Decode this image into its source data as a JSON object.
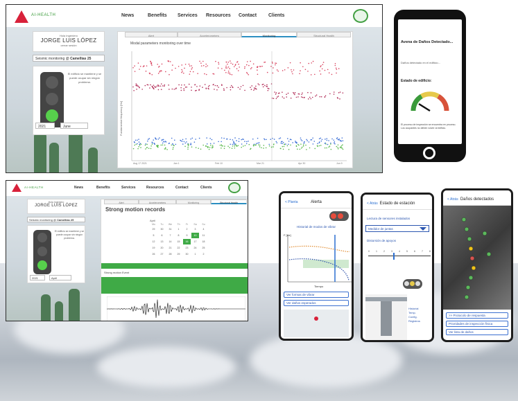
{
  "site": {
    "brand": "AI-HEALTH",
    "nav": [
      "News",
      "Benefits",
      "Services",
      "Resources",
      "Contact",
      "Clients"
    ]
  },
  "dashboard_top": {
    "welcome": "Hola Ingeniero",
    "user_name": "JORGE LUIS LÓPEZ",
    "logout": "cerrar sesión",
    "monitoring_label": "Seismic monitoring @",
    "site_name": "Camellias 25",
    "status_text": "El edificio se mantiene y se puede ocupar sin ningún problema.",
    "years": [
      "2021",
      "June"
    ],
    "tabs": [
      "Alert",
      "Accelerometers",
      "Monitoring",
      "Structural Health"
    ],
    "active_tab": "Monitoring",
    "chart_title": "Modal parameters monitoring over time",
    "ylabel": "Fundamental frequency [Hz]",
    "x_ticks": [
      "Aug 17 2021",
      "Jan 1",
      "Feb 10",
      "Mar 21",
      "Apr 30",
      "Jun 9"
    ]
  },
  "dashboard_bottom": {
    "welcome": "Hola Ingeniero",
    "user_name": "JORGE LUIS LÓPEZ",
    "monitoring_label": "Seismic monitoring @",
    "site_name": "Camellias 25",
    "status_text": "El edificio se mantiene y se puede ocupar sin ningún problema.",
    "years": [
      "2021",
      "April"
    ],
    "tabs": [
      "Alert",
      "Accelerometers",
      "Monitoring",
      "Structural Health"
    ],
    "active_tab": "Structural Health",
    "section_title": "Strong motion records",
    "calendar": {
      "month": "April",
      "weekdays": [
        "Mo",
        "Tu",
        "We",
        "Th",
        "Fr",
        "Sa",
        "Su"
      ],
      "days": [
        "29",
        "30",
        "31",
        "1",
        "2",
        "3",
        "4",
        "5",
        "6",
        "7",
        "8",
        "9",
        "10",
        "11",
        "12",
        "13",
        "14",
        "15",
        "16",
        "17",
        "18",
        "19",
        "20",
        "21",
        "22",
        "23",
        "24",
        "25",
        "26",
        "27",
        "28",
        "29",
        "30",
        "1",
        "2"
      ],
      "highlighted": [
        "10",
        "16"
      ]
    },
    "record_label": "Strong motion Event",
    "waveform_labels": [
      "Acceleration",
      "Velocity"
    ]
  },
  "phone_main": {
    "header": "Avena de Daños Detectado...",
    "item": "Daños detectado en el edificio...",
    "gauge_title": "Estado de edificio:",
    "body_text": "El proceso de inspección se encuentra en proceso. Los ocupantes no deben volver al edificio."
  },
  "phone_alert": {
    "back": "< Planta",
    "title": "Alerta",
    "chart_title": "Historial de modos de vibrar",
    "ylabel": "F [Hz]",
    "xlabel": "Tiempo",
    "buttons": [
      "Ver formas de vibrar",
      "Ver daños esperados"
    ]
  },
  "phone_station": {
    "back": "< Atrás",
    "title": "Estado de estación",
    "label1": "Lectura de sensores instalados",
    "dropdown": "Medidor de juntas",
    "label2": "Distorsión de apoyos",
    "scale": [
      "0",
      "1",
      "2",
      "3",
      "4",
      "5",
      "6",
      "7",
      "8"
    ],
    "history": "Historial",
    "side_items": [
      "Temp.",
      "Config.",
      "Registros"
    ]
  },
  "phone_damage": {
    "back": "< Atrás",
    "title": "Daños detectados",
    "buttons": [
      ">> Protocolo de respuesta",
      "Prioridades de inspección física",
      "Ver lista de daños"
    ]
  },
  "colors": {
    "accent_green": "#3faa46",
    "brand_red": "#d8213a",
    "link_blue": "#2b6fd0"
  }
}
